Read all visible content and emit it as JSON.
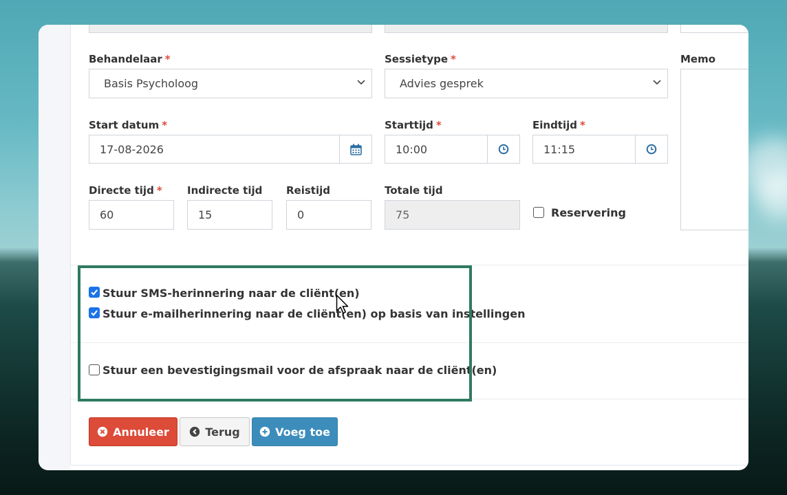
{
  "form": {
    "behandelaar": {
      "label": "Behandelaar",
      "required": "*",
      "value": "Basis Psycholoog"
    },
    "sessietype": {
      "label": "Sessietype",
      "required": "*",
      "value": "Advies gesprek"
    },
    "memo": {
      "label": "Memo"
    },
    "start_datum": {
      "label": "Start datum",
      "required": "*",
      "value": "17-08-2026",
      "icon": "calendar-icon"
    },
    "starttijd": {
      "label": "Starttijd",
      "required": "*",
      "value": "10:00",
      "icon": "clock-icon"
    },
    "eindtijd": {
      "label": "Eindtijd",
      "required": "*",
      "value": "11:15",
      "icon": "clock-icon"
    },
    "directe_tijd": {
      "label": "Directe tijd",
      "required": "*",
      "value": "60"
    },
    "indirecte_tijd": {
      "label": "Indirecte tijd",
      "value": "15"
    },
    "reistijd": {
      "label": "Reistijd",
      "value": "0"
    },
    "totale_tijd": {
      "label": "Totale tijd",
      "value": "75"
    },
    "reservering": {
      "label": "Reservering",
      "checked": false
    }
  },
  "options": {
    "sms_reminder": {
      "label": "Stuur SMS-herinnering naar de cliënt(en)",
      "checked": true
    },
    "email_reminder": {
      "label": "Stuur e-mailherinnering naar de cliënt(en) op basis van instellingen",
      "checked": true
    },
    "confirmation_mail": {
      "label": "Stuur een bevestigingsmail voor de afspraak naar de cliënt(en)",
      "checked": false
    }
  },
  "buttons": {
    "cancel": {
      "label": "Annuleer",
      "icon": "times-circle-icon"
    },
    "back": {
      "label": "Terug",
      "icon": "arrow-circle-left-icon"
    },
    "add": {
      "label": "Voeg toe",
      "icon": "plus-circle-icon"
    }
  },
  "colors": {
    "danger": "#dd4b39",
    "primary": "#3c8dbc",
    "checkbox": "#1a73e8",
    "highlight": "#2e7b5f"
  }
}
